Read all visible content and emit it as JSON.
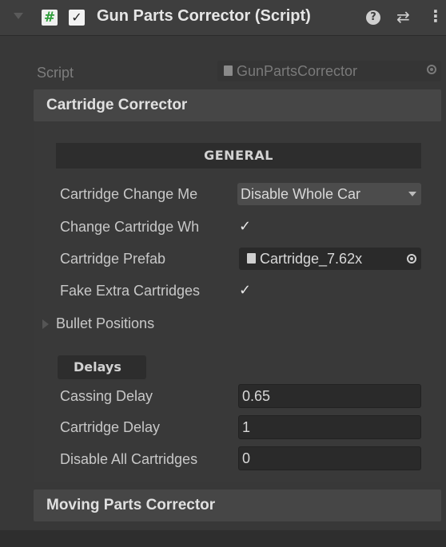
{
  "component": {
    "title": "Gun Parts Corrector (Script)",
    "script_icon": "#",
    "enabled_check": "✓",
    "help_icon": "?",
    "preset_icon": "⇄",
    "menu_icon": "⋮"
  },
  "script_row": {
    "label": "Script",
    "value": "GunPartsCorrector"
  },
  "cartridge_corrector": {
    "title": "Cartridge Corrector",
    "general_header": "GENERAL",
    "change_method": {
      "label": "Cartridge Change Me",
      "value": "Disable Whole Car"
    },
    "change_when": {
      "label": "Change Cartridge Wh",
      "checked": "✓"
    },
    "prefab": {
      "label": "Cartridge Prefab",
      "value": "Cartridge_7.62x"
    },
    "fake_extra": {
      "label": "Fake Extra Cartridges",
      "checked": "✓"
    },
    "bullet_positions": {
      "label": "Bullet Positions"
    },
    "delays": {
      "header": "Delays",
      "casing": {
        "label": "Cassing Delay",
        "value": "0.65"
      },
      "cartridge": {
        "label": "Cartridge Delay",
        "value": "1"
      },
      "disable_all": {
        "label": "Disable All Cartridges",
        "value": "0"
      }
    }
  },
  "moving_parts": {
    "title": "Moving Parts Corrector"
  }
}
